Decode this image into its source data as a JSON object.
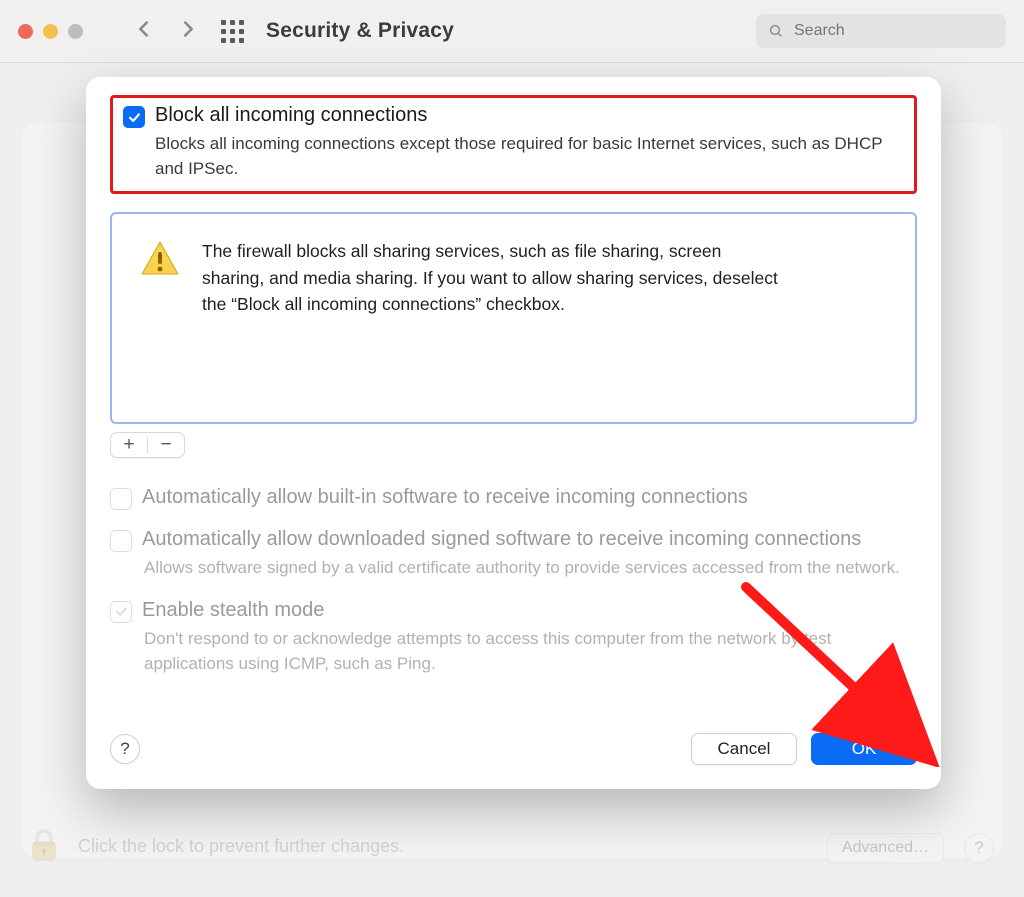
{
  "window": {
    "title": "Security & Privacy",
    "search_placeholder": "Search"
  },
  "modal": {
    "block_all": {
      "label": "Block all incoming connections",
      "description": "Blocks all incoming connections except those required for basic Internet services, such as DHCP and IPSec."
    },
    "warning_message": "The firewall blocks all sharing services, such as file sharing, screen sharing, and media sharing. If you want to allow sharing services, deselect the “Block all incoming connections” checkbox.",
    "auto_builtin": {
      "label": "Automatically allow built-in software to receive incoming connections"
    },
    "auto_signed": {
      "label": "Automatically allow downloaded signed software to receive incoming connections",
      "description": "Allows software signed by a valid certificate authority to provide services accessed from the network."
    },
    "stealth": {
      "label": "Enable stealth mode",
      "description": "Don't respond to or acknowledge attempts to access this computer from the network by test applications using ICMP, such as Ping."
    },
    "plus_label": "+",
    "minus_label": "−",
    "help_label": "?",
    "cancel_label": "Cancel",
    "ok_label": "OK"
  },
  "background": {
    "lock_hint": "Click the lock to prevent further changes.",
    "advanced_label": "Advanced…",
    "help_label": "?"
  }
}
